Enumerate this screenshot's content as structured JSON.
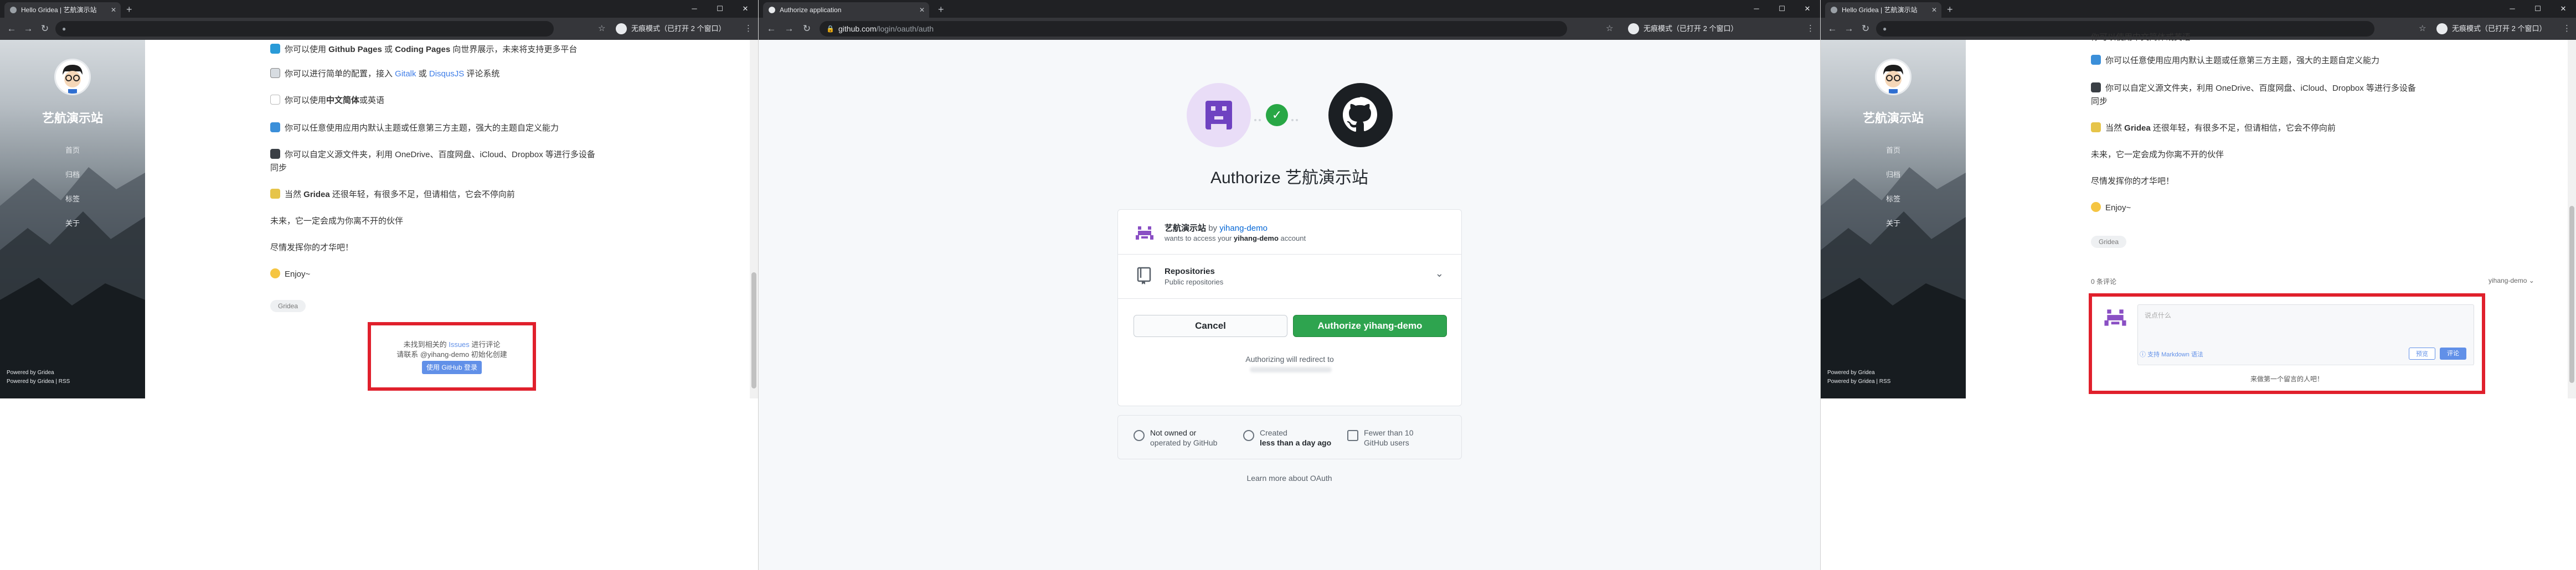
{
  "left_window": {
    "tab_title": "Hello Gridea | 艺航演示站",
    "incognito_label": "无痕模式（已打开 2 个窗口）",
    "site_title": "艺航演示站",
    "nav": [
      "首页",
      "归档",
      "标签",
      "关于"
    ],
    "footer_line1": "Powered by Gridea",
    "footer_line2": "Powered by Gridea | RSS",
    "paragraphs": [
      {
        "pre": "你可以使用 ",
        "b1": "Github Pages",
        "mid": " 或 ",
        "b2": "Coding Pages",
        "post": " 向世界展示，未来将支持更多平台"
      },
      {
        "pre": "你可以进行简单的配置，接入 ",
        "l1": "Gitalk",
        "mid": " 或 ",
        "l2": "DisqusJS",
        "post": " 评论系统"
      },
      {
        "pre": "你可以使用",
        "b1": "中文简体",
        "post": "或英语"
      },
      {
        "text": "你可以任意使用应用内默认主题或任意第三方主题，强大的主题自定义能力"
      },
      {
        "text1": "你可以自定义源文件夹，利用 OneDrive、百度网盘、iCloud、Dropbox 等进行多设备",
        "text2": "同步"
      },
      {
        "pre": "当然 ",
        "b1": "Gridea",
        "post": " 还很年轻，有很多不足，但请相信，它会不停向前"
      },
      {
        "text": "未来，它一定会成为你离不开的伙伴"
      },
      {
        "text": "尽情发挥你的才华吧！"
      },
      {
        "text": "Enjoy~"
      }
    ],
    "tag": "Gridea",
    "comment_line1_pre": "未找到相关的 ",
    "comment_line1_link": "Issues",
    "comment_line1_post": " 进行评论",
    "comment_line2": "请联系 @yihang-demo 初始化创建",
    "comment_button": "使用 GitHub 登录"
  },
  "middle_window": {
    "tab_title": "Authorize application",
    "incognito_label": "无痕模式（已打开 2 个窗口）",
    "url_host": "github.com",
    "url_path": "/login/oauth/auth",
    "title": "Authorize 艺航演示站",
    "app_name": "艺航演示站",
    "by": "by",
    "owner": "yihang-demo",
    "wants_pre": "wants to access your ",
    "wants_account": "yihang-demo",
    "wants_post": " account",
    "repo_title": "Repositories",
    "repo_sub": "Public repositories",
    "cancel": "Cancel",
    "authorize": "Authorize yihang-demo",
    "redirect": "Authorizing will redirect to",
    "footer": [
      {
        "line1": "Not owned or",
        "line2": "operated by GitHub"
      },
      {
        "line1": "Created",
        "line2": "less than a day ago"
      },
      {
        "line1": "Fewer than 10",
        "line2": "GitHub users"
      }
    ],
    "learn_more": "Learn more about OAuth"
  },
  "right_window": {
    "tab_title": "Hello Gridea | 艺航演示站",
    "incognito_label": "无痕模式（已打开 2 个窗口）",
    "site_title": "艺航演示站",
    "nav": [
      "首页",
      "归档",
      "标签",
      "关于"
    ],
    "footer_line1": "Powered by Gridea",
    "footer_line2": "Powered by Gridea | RSS",
    "paragraphs": [
      {
        "text": "你可以使用中文简体或英语"
      },
      {
        "text": "你可以任意使用应用内默认主题或任意第三方主题，强大的主题自定义能力"
      },
      {
        "text1": "你可以自定义源文件夹，利用 OneDrive、百度网盘、iCloud、Dropbox 等进行多设备",
        "text2": "同步"
      },
      {
        "pre": "当然 ",
        "b1": "Gridea",
        "post": " 还很年轻，有很多不足，但请相信，它会不停向前"
      },
      {
        "text": "未来，它一定会成为你离不开的伙伴"
      },
      {
        "text": "尽情发挥你的才华吧！"
      },
      {
        "text": "Enjoy~"
      }
    ],
    "tag": "Gridea",
    "comment_count": "0 条评论",
    "user_menu": "yihang-demo ⌄",
    "comment_placeholder": "说点什么",
    "markdown_hint": "支持 Markdown 语法",
    "preview": "预览",
    "submit": "评论",
    "first_comment": "来做第一个留言的人吧！"
  },
  "colors": {
    "accent_red": "#e0202c",
    "github_green": "#2ea44f",
    "link_blue": "#0366d6",
    "gitalk_blue": "#6190e8"
  }
}
